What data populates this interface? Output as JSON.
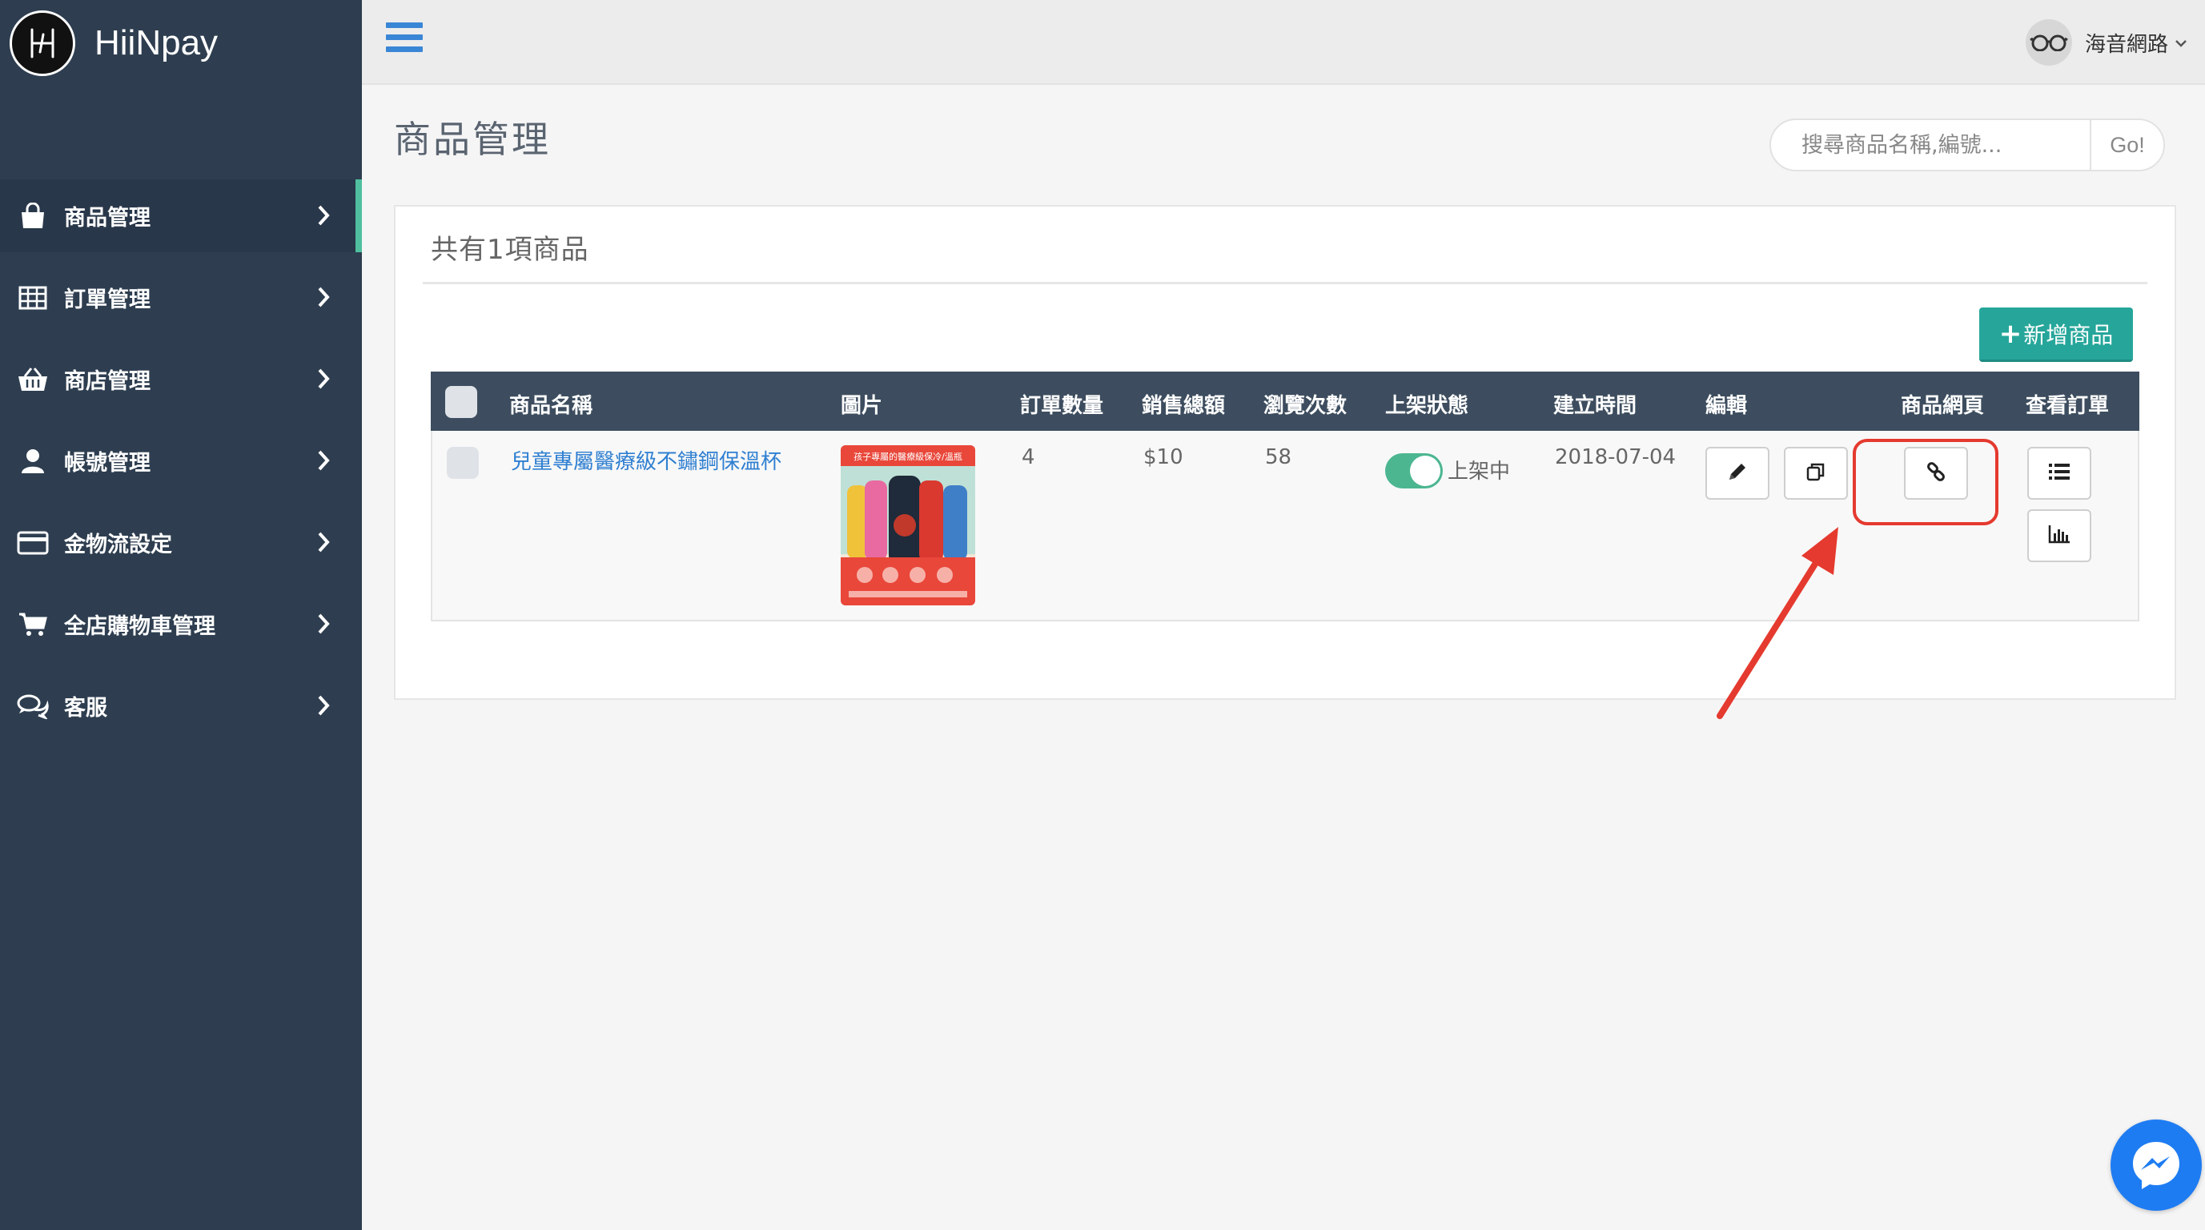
{
  "brand": {
    "name": "HiiNpay",
    "logo_icon": "hiinpay-logo-icon"
  },
  "sidebar": {
    "items": [
      {
        "label": "商品管理",
        "icon": "shopping-bag-icon",
        "active": true
      },
      {
        "label": "訂單管理",
        "icon": "table-icon"
      },
      {
        "label": "商店管理",
        "icon": "basket-icon"
      },
      {
        "label": "帳號管理",
        "icon": "user-icon"
      },
      {
        "label": "金物流設定",
        "icon": "credit-card-icon"
      },
      {
        "label": "全店購物車管理",
        "icon": "cart-icon"
      },
      {
        "label": "客服",
        "icon": "chat-icon"
      }
    ]
  },
  "topbar": {
    "menu_icon": "hamburger-menu-icon",
    "user_name": "海音網路"
  },
  "page": {
    "title": "商品管理"
  },
  "search": {
    "placeholder": "搜尋商品名稱,編號...",
    "button_label": "Go!"
  },
  "panel": {
    "title": "共有1項商品",
    "add_button_label": "新增商品"
  },
  "table": {
    "headers": [
      "商品名稱",
      "圖片",
      "訂單數量",
      "銷售總額",
      "瀏覽次數",
      "上架狀態",
      "建立時間",
      "編輯",
      "商品網頁",
      "查看訂單"
    ],
    "rows": [
      {
        "name": "兒童專屬醫療級不鏽鋼保溫杯",
        "image_caption": "孩子專屬的醫療級保冷/溫瓶",
        "orders": "4",
        "sales_total": "$10",
        "views": "58",
        "status_on": true,
        "status_label": "上架中",
        "created": "2018-07-04"
      }
    ]
  },
  "colors": {
    "sidebar_bg": "#2e3e50",
    "accent": "#26a69a",
    "link": "#2f7fd1",
    "highlight": "#e53a2f",
    "table_header": "#3d4d5f",
    "toggle_on": "#4cb691"
  }
}
